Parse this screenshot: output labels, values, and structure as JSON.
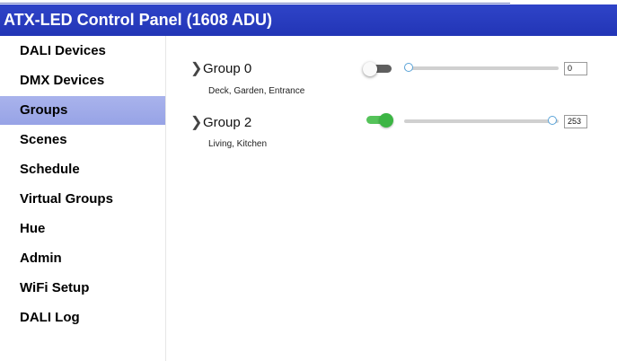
{
  "header": {
    "title": "ATX-LED Control Panel (1608 ADU)"
  },
  "sidebar": {
    "items": [
      {
        "label": "DALI Devices",
        "active": false
      },
      {
        "label": "DMX Devices",
        "active": false
      },
      {
        "label": "Groups",
        "active": true
      },
      {
        "label": "Scenes",
        "active": false
      },
      {
        "label": "Schedule",
        "active": false
      },
      {
        "label": "Virtual Groups",
        "active": false
      },
      {
        "label": "Hue",
        "active": false
      },
      {
        "label": "Admin",
        "active": false
      },
      {
        "label": "WiFi Setup",
        "active": false
      },
      {
        "label": "DALI Log",
        "active": false
      }
    ]
  },
  "groups": [
    {
      "name": "Group 0",
      "description": "Deck, Garden, Entrance",
      "on": false,
      "level": "0",
      "level_fraction": 0.0
    },
    {
      "name": "Group 2",
      "description": "Living, Kitchen",
      "on": true,
      "level": "253",
      "level_fraction": 0.99
    }
  ],
  "colors": {
    "header": "#2a3dc0",
    "active_nav": "#a0abe9",
    "toggle_on": "#3cb544",
    "toggle_off": "#5f5f5f",
    "slider_thumb_border": "#5aa3d8"
  }
}
